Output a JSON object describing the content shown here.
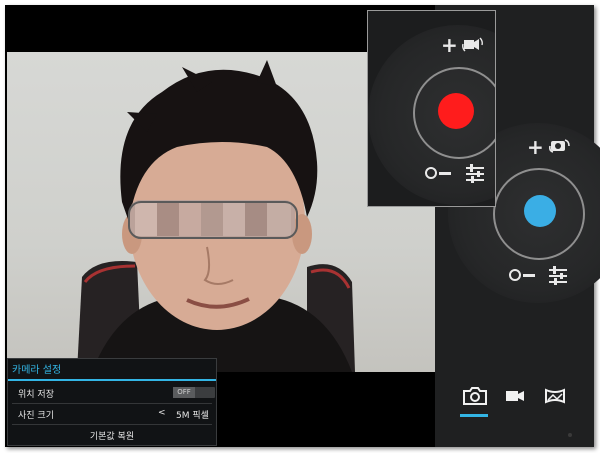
{
  "viewfinder": {
    "subject": "person-with-blurred-eyes"
  },
  "video_dial": {
    "plus_label": "+",
    "minus_label": "−",
    "shutter_color": "#ff1c1c",
    "mode_icon": "video-switch-icon",
    "settings_icon": "sliders-icon"
  },
  "camera_dial": {
    "plus_label": "+",
    "minus_label": "−",
    "shutter_color": "#3aaee5",
    "mode_icon": "camera-switch-icon",
    "settings_icon": "sliders-icon"
  },
  "mode_bar": {
    "items": [
      "camera-icon",
      "video-icon",
      "panorama-icon"
    ],
    "active": "camera-icon",
    "accent": "#33b5e5"
  },
  "settings_panel": {
    "title": "카메라 설정",
    "rows": [
      {
        "label": "위치 저장",
        "value": "OFF"
      },
      {
        "label": "사진 크기",
        "arrow": "<",
        "value": "5M 픽셀"
      }
    ],
    "reset_label": "기본값 복원"
  }
}
